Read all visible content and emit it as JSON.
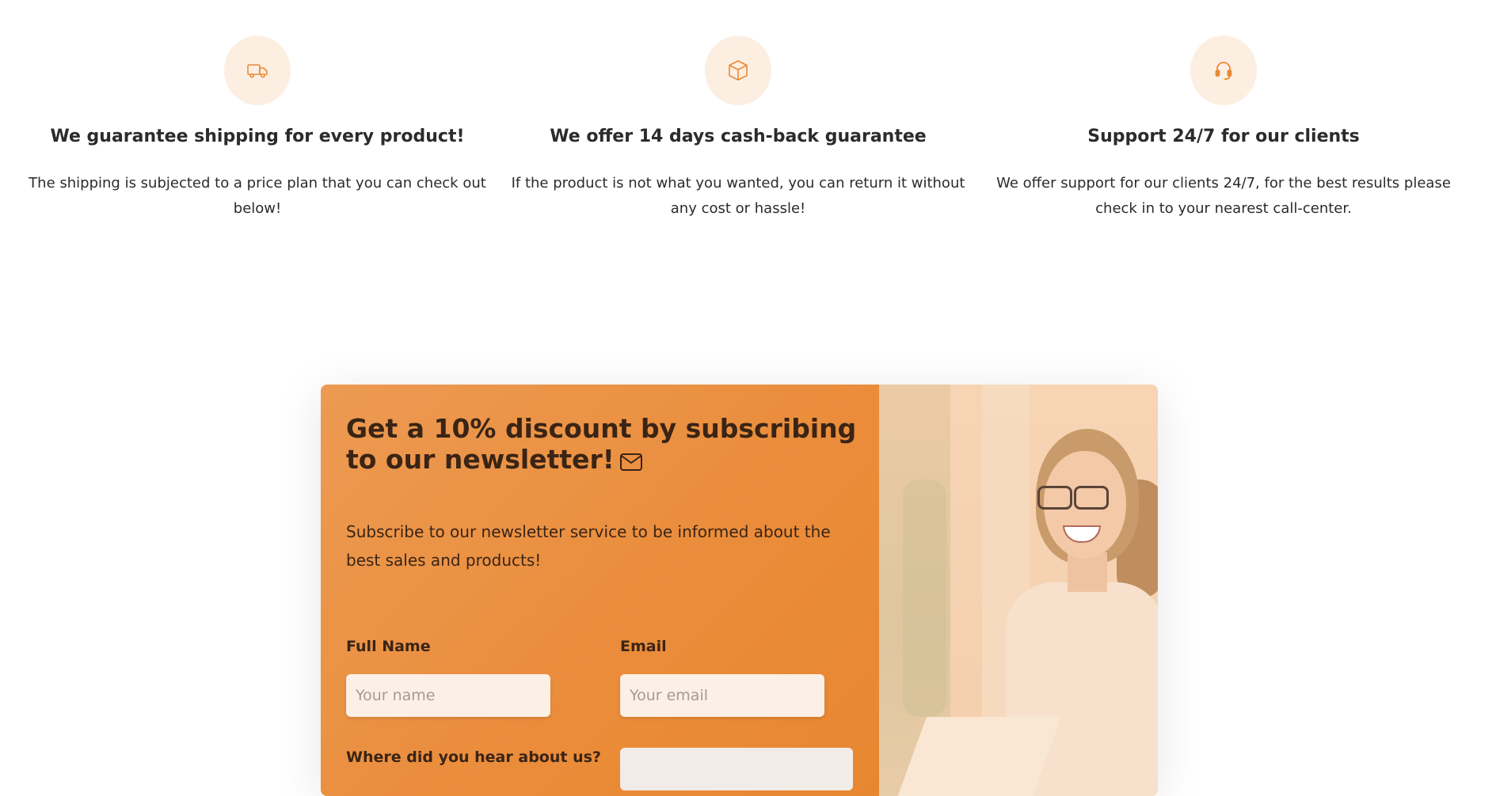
{
  "features": [
    {
      "icon": "truck-icon",
      "title": "We guarantee shipping for every product!",
      "description": "The shipping is subjected to a price plan that you can check out below!"
    },
    {
      "icon": "box-icon",
      "title": "We offer 14 days cash-back guarantee",
      "description": "If the product is not what you wanted, you can return it without any cost or hassle!"
    },
    {
      "icon": "headset-icon",
      "title": "Support 24/7 for our clients",
      "description": "We offer support for our clients 24/7, for the best results please check in to your nearest call-center."
    }
  ],
  "newsletter": {
    "title": "Get a 10% discount by subscribing to our newsletter!",
    "title_icon": "mail-icon",
    "description": "Subscribe to our newsletter service to be informed about the best sales and products!",
    "full_name_label": "Full Name",
    "full_name_placeholder": "Your name",
    "email_label": "Email",
    "email_placeholder": "Your email",
    "hear_label": "Where did you hear about us?",
    "hear_selected": ""
  },
  "colors": {
    "accent": "#e88a36",
    "icon_bg": "#fdeee2",
    "text": "#2b2b2b"
  }
}
